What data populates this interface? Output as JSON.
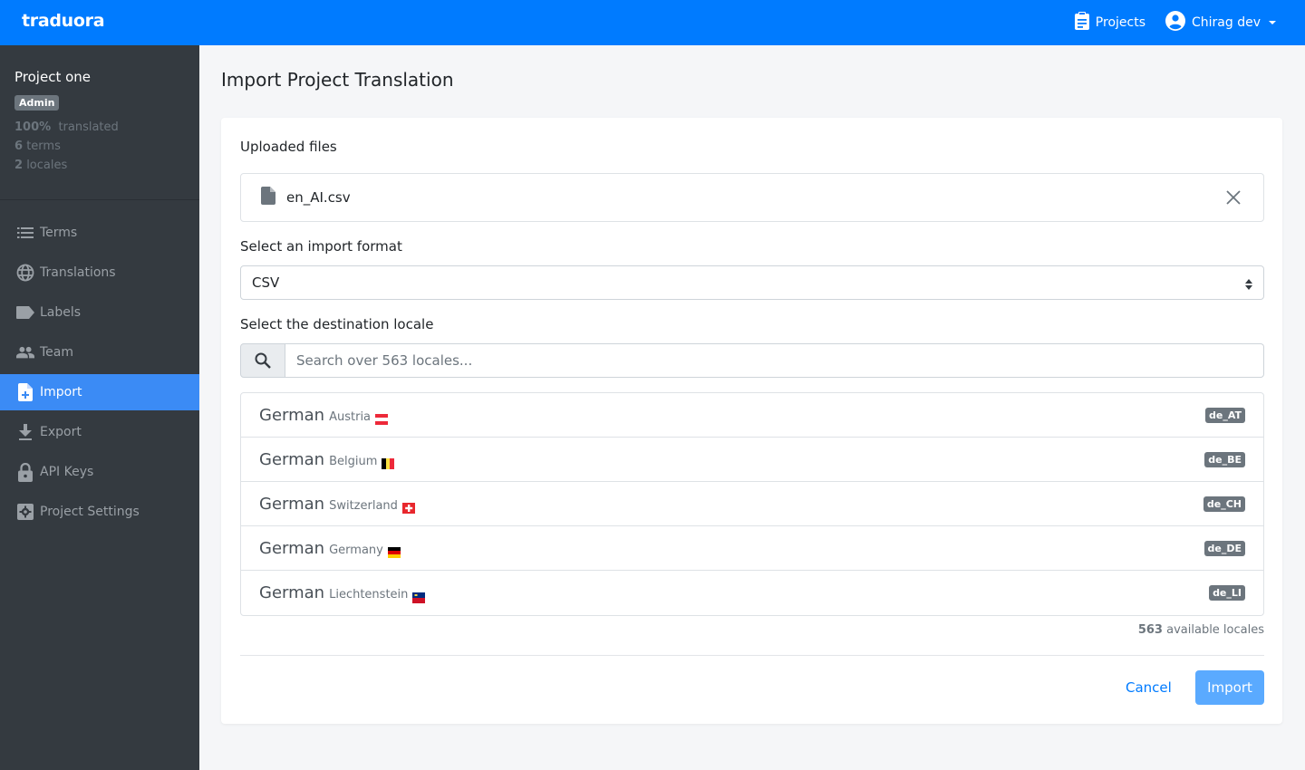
{
  "topbar": {
    "brand": "traduora",
    "projects_link": "Projects",
    "user_name": "Chirag dev",
    "accent": "#007bff"
  },
  "sidebar": {
    "project_name": "Project one",
    "role_badge": "Admin",
    "stats": {
      "translated_pct": "100%",
      "translated_label": "translated",
      "terms_count": "6",
      "terms_label": "terms",
      "locales_count": "2",
      "locales_label": "locales"
    },
    "items": [
      {
        "label": "Terms",
        "icon": "list-icon"
      },
      {
        "label": "Translations",
        "icon": "globe-icon"
      },
      {
        "label": "Labels",
        "icon": "label-icon"
      },
      {
        "label": "Team",
        "icon": "people-icon"
      },
      {
        "label": "Import",
        "icon": "file-plus-icon",
        "active": true
      },
      {
        "label": "Export",
        "icon": "download-icon"
      },
      {
        "label": "API Keys",
        "icon": "lock-icon"
      },
      {
        "label": "Project Settings",
        "icon": "gear-icon"
      }
    ]
  },
  "main": {
    "title": "Import Project Translation",
    "uploaded_label": "Uploaded files",
    "file_name": "en_AI.csv",
    "format_label": "Select an import format",
    "format_value": "CSV",
    "locale_label": "Select the destination locale",
    "search_placeholder": "Search over 563 locales...",
    "locales": [
      {
        "language": "German",
        "region": "Austria",
        "code": "de_AT",
        "flag": "AT"
      },
      {
        "language": "German",
        "region": "Belgium",
        "code": "de_BE",
        "flag": "BE"
      },
      {
        "language": "German",
        "region": "Switzerland",
        "code": "de_CH",
        "flag": "CH"
      },
      {
        "language": "German",
        "region": "Germany",
        "code": "de_DE",
        "flag": "DE"
      },
      {
        "language": "German",
        "region": "Liechtenstein",
        "code": "de_LI",
        "flag": "LI"
      }
    ],
    "available_count": "563",
    "available_label": "available locales",
    "cancel_label": "Cancel",
    "import_label": "Import"
  }
}
